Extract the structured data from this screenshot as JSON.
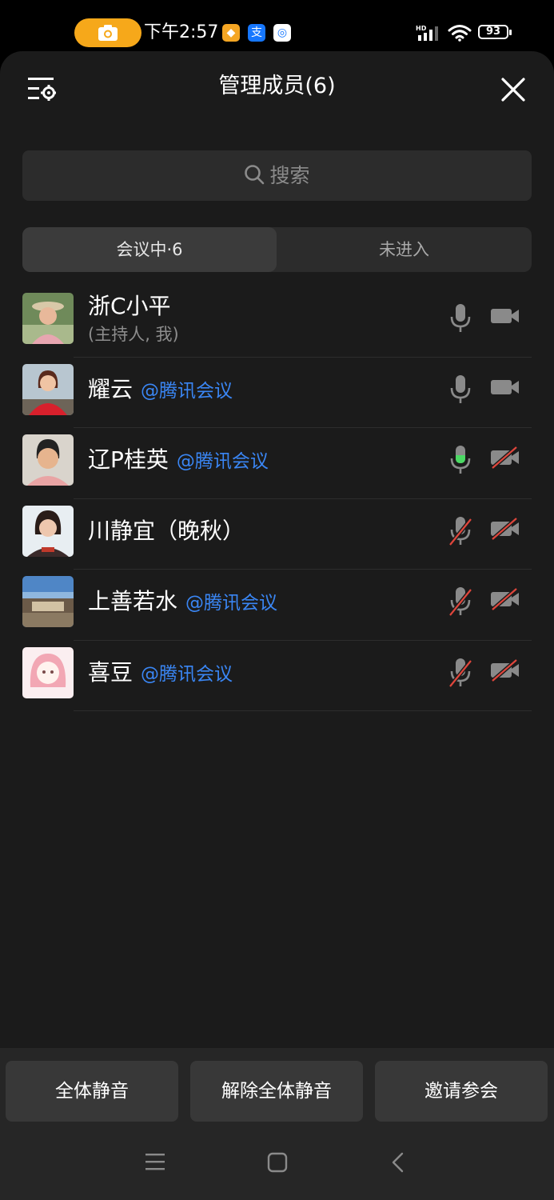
{
  "status": {
    "time": "下午2:57",
    "battery": "93",
    "signal_label": "HD"
  },
  "header": {
    "title": "管理成员(6)"
  },
  "search": {
    "placeholder": "搜索"
  },
  "tabs": [
    {
      "label": "会议中·6",
      "active": true
    },
    {
      "label": "未进入",
      "active": false
    }
  ],
  "members": [
    {
      "name": "浙C小平",
      "tag": "",
      "sub": "(主持人, 我)",
      "mic": "on",
      "mic_speaking": false,
      "video": "on"
    },
    {
      "name": "耀云",
      "tag": "@腾讯会议",
      "sub": "",
      "mic": "on",
      "mic_speaking": false,
      "video": "on"
    },
    {
      "name": "辽P桂英",
      "tag": "@腾讯会议",
      "sub": "",
      "mic": "on",
      "mic_speaking": true,
      "video": "off"
    },
    {
      "name": "川静宜（晚秋）",
      "tag": "",
      "sub": "",
      "mic": "off",
      "mic_speaking": false,
      "video": "off"
    },
    {
      "name": "上善若水",
      "tag": "@腾讯会议",
      "sub": "",
      "mic": "off",
      "mic_speaking": false,
      "video": "off"
    },
    {
      "name": "喜豆",
      "tag": "@腾讯会议",
      "sub": "",
      "mic": "off",
      "mic_speaking": false,
      "video": "off"
    }
  ],
  "actions": {
    "mute_all": "全体静音",
    "unmute_all": "解除全体静音",
    "invite": "邀请参会"
  },
  "colors": {
    "accent_blue": "#3a86f4",
    "speaking_green": "#4cd964",
    "muted_red": "#e0463c",
    "camera_pill": "#f6a81a"
  }
}
